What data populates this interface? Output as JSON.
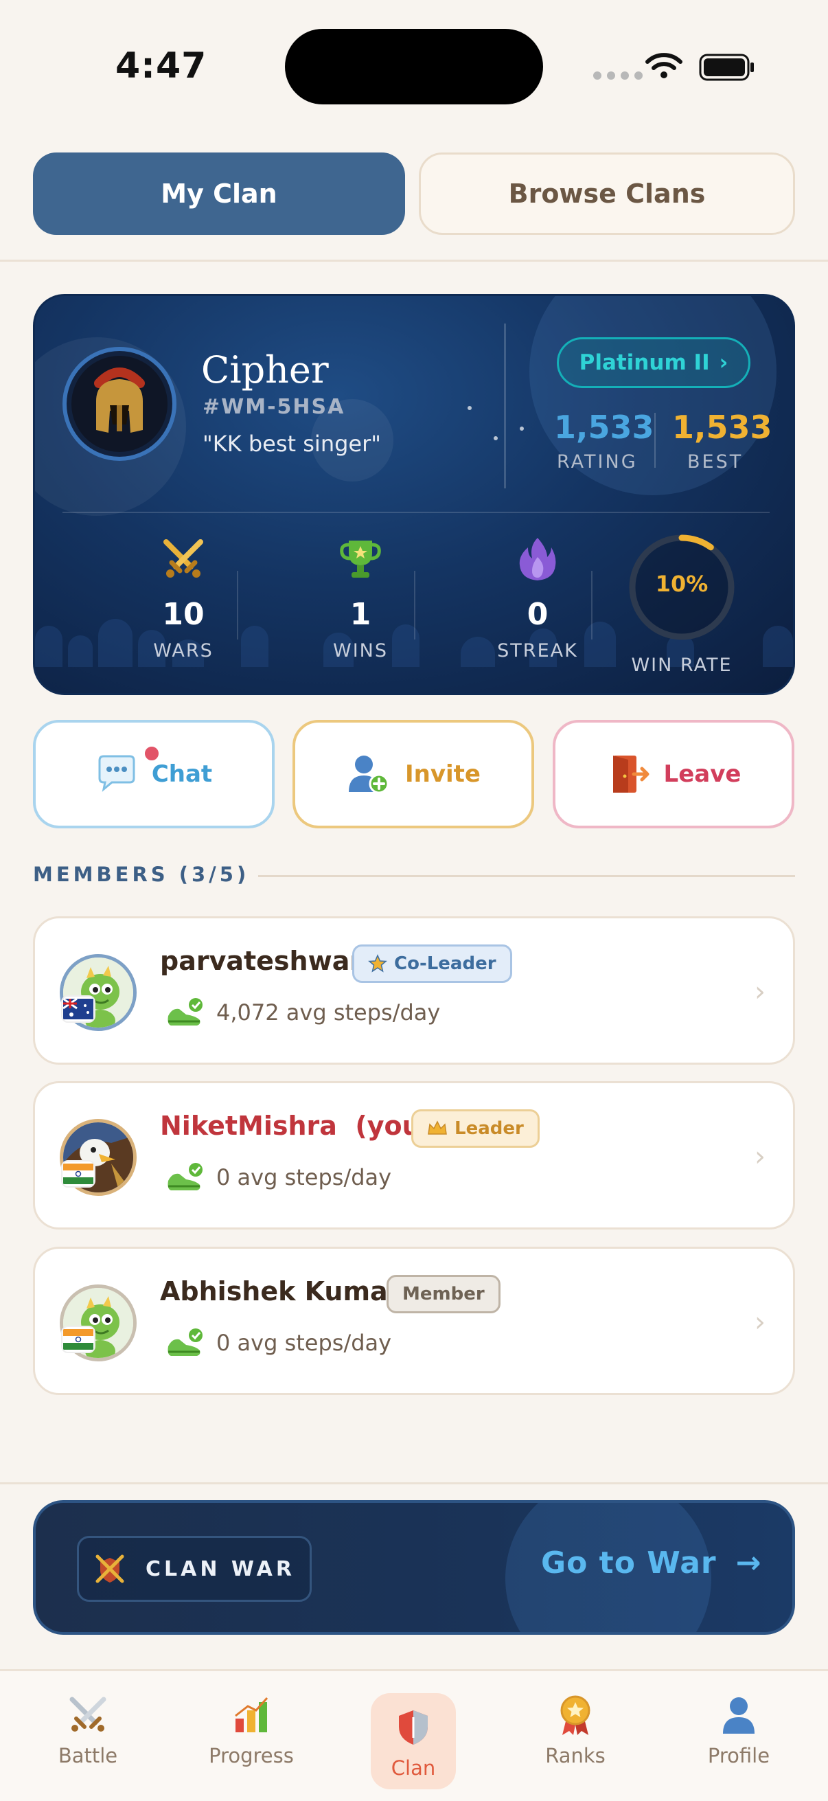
{
  "status_bar": {
    "time": "4:47"
  },
  "tabs": {
    "my_clan": "My Clan",
    "browse_clans": "Browse Clans"
  },
  "clan": {
    "name": "Cipher",
    "tag": "#WM-5HSA",
    "motto": "\"KK best singer\"",
    "tier": "Platinum II",
    "tier_chevron": "›",
    "rating": "1,533",
    "rating_label": "RATING",
    "best": "1,533",
    "best_label": "BEST",
    "stats": [
      {
        "value": "10",
        "label": "WARS",
        "icon": "crossed-swords-icon"
      },
      {
        "value": "1",
        "label": "WINS",
        "icon": "trophy-icon"
      },
      {
        "value": "0",
        "label": "STREAK",
        "icon": "flame-icon"
      }
    ],
    "win_rate": {
      "text": "10%",
      "label": "WIN RATE",
      "fraction": 0.1
    }
  },
  "actions": {
    "chat": "Chat",
    "invite": "Invite",
    "leave": "Leave"
  },
  "members_heading": "MEMBERS (3/5)",
  "members": [
    {
      "name": "parvateshwar",
      "role": "Co-Leader",
      "steps": "4,072 avg steps/day",
      "flag": "AU"
    },
    {
      "name": "NiketMishra",
      "you": "(you)",
      "role": "Leader",
      "steps": "0 avg steps/day",
      "flag": "IN"
    },
    {
      "name": "Abhishek Kumar",
      "role": "Member",
      "steps": "0 avg steps/day",
      "flag": "IN"
    }
  ],
  "war_banner": {
    "chip_label": "CLAN WAR",
    "cta": "Go to War",
    "arrow": "→"
  },
  "nav": [
    {
      "label": "Battle",
      "icon": "battle-icon"
    },
    {
      "label": "Progress",
      "icon": "progress-icon"
    },
    {
      "label": "Clan",
      "icon": "clan-shield-icon",
      "active": true
    },
    {
      "label": "Ranks",
      "icon": "ranks-medal-icon"
    },
    {
      "label": "Profile",
      "icon": "profile-icon"
    }
  ],
  "colors": {
    "accent_blue": "#3f6690",
    "gold": "#f0b232",
    "rating_blue": "#4aa6e0",
    "leave_red": "#d23e5c",
    "nav_active": "#e05a3d"
  }
}
